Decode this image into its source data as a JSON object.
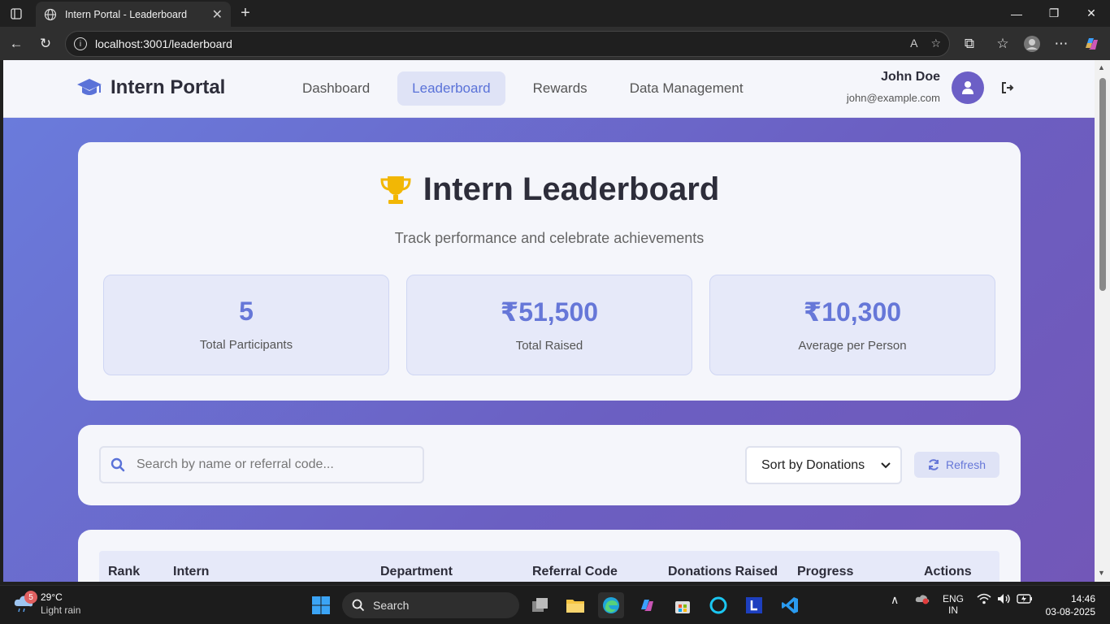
{
  "browser": {
    "tab_title": "Intern Portal - Leaderboard",
    "url": "localhost:3001/leaderboard"
  },
  "header": {
    "brand": "Intern Portal",
    "nav": [
      {
        "label": "Dashboard",
        "active": false
      },
      {
        "label": "Leaderboard",
        "active": true
      },
      {
        "label": "Rewards",
        "active": false
      },
      {
        "label": "Data Management",
        "active": false
      }
    ],
    "user": {
      "name": "John Doe",
      "email": "john@example.com"
    }
  },
  "hero": {
    "title": "Intern Leaderboard",
    "subtitle": "Track performance and celebrate achievements",
    "stats": [
      {
        "value": "5",
        "label": "Total Participants"
      },
      {
        "value": "₹51,500",
        "label": "Total Raised"
      },
      {
        "value": "₹10,300",
        "label": "Average per Person"
      }
    ]
  },
  "filters": {
    "search_placeholder": "Search by name or referral code...",
    "sort_value": "Sort by Donations",
    "refresh_label": "Refresh"
  },
  "table": {
    "columns": [
      "Rank",
      "Intern",
      "Department",
      "Referral Code",
      "Donations Raised",
      "Progress",
      "Actions"
    ]
  },
  "taskbar": {
    "weather_temp": "29°C",
    "weather_desc": "Light rain",
    "weather_badge": "5",
    "search_label": "Search",
    "lang_top": "ENG",
    "lang_bottom": "IN",
    "time": "14:46",
    "date": "03-08-2025"
  },
  "colors": {
    "accent": "#6677d8",
    "page_gradient_start": "#6a7ddd",
    "page_gradient_end": "#7257b8",
    "card_bg": "#f5f6fb",
    "stat_bg": "#e6e9f9",
    "trophy": "#f2b705"
  }
}
